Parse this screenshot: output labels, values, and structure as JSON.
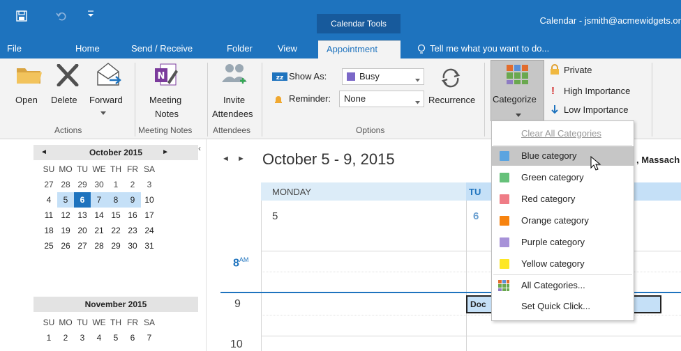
{
  "window": {
    "title": "Calendar - jsmith@acmewidgets.or",
    "contextual_tab_group": "Calendar Tools"
  },
  "tabs": [
    {
      "label": "File"
    },
    {
      "label": "Home"
    },
    {
      "label": "Send / Receive"
    },
    {
      "label": "Folder"
    },
    {
      "label": "View"
    },
    {
      "label": "Appointment"
    },
    {
      "label": "Tell me what you want to do..."
    }
  ],
  "ribbon": {
    "actions": {
      "open": "Open",
      "delete": "Delete",
      "forward": "Forward",
      "group": "Actions"
    },
    "meeting_notes": {
      "label1": "Meeting",
      "label2": "Notes",
      "group": "Meeting Notes"
    },
    "attendees": {
      "label1": "Invite",
      "label2": "Attendees",
      "group": "Attendees"
    },
    "options": {
      "show_as_label": "Show As:",
      "show_as_value": "Busy",
      "reminder_label": "Reminder:",
      "reminder_value": "None",
      "recurrence": "Recurrence",
      "group": "Options"
    },
    "tags": {
      "categorize": "Categorize",
      "private": "Private",
      "high_importance": "High Importance",
      "low_importance": "Low Importance"
    }
  },
  "categorize_menu": {
    "clear_all": "Clear All Categories",
    "items": [
      {
        "label": "Blue category",
        "color": "#5ba4e0"
      },
      {
        "label": "Green category",
        "color": "#66c17a"
      },
      {
        "label": "Red category",
        "color": "#ef7c86"
      },
      {
        "label": "Orange category",
        "color": "#f7830f"
      },
      {
        "label": "Purple category",
        "color": "#a792d8"
      },
      {
        "label": "Yellow category",
        "color": "#fde724"
      }
    ],
    "all_categories": "All Categories...",
    "set_quick_click": "Set Quick Click..."
  },
  "mini_calendar": {
    "october": {
      "title": "October 2015",
      "weekdays": [
        "SU",
        "MO",
        "TU",
        "WE",
        "TH",
        "FR",
        "SA"
      ],
      "weeks": [
        [
          "27",
          "28",
          "29",
          "30",
          "1",
          "2",
          "3"
        ],
        [
          "4",
          "5",
          "6",
          "7",
          "8",
          "9",
          "10"
        ],
        [
          "11",
          "12",
          "13",
          "14",
          "15",
          "16",
          "17"
        ],
        [
          "18",
          "19",
          "20",
          "21",
          "22",
          "23",
          "24"
        ],
        [
          "25",
          "26",
          "27",
          "28",
          "29",
          "30",
          "31"
        ]
      ]
    },
    "november": {
      "title": "November 2015",
      "weekdays": [
        "SU",
        "MO",
        "TU",
        "WE",
        "TH",
        "FR",
        "SA"
      ],
      "weeks": [
        [
          "1",
          "2",
          "3",
          "4",
          "5",
          "6",
          "7"
        ]
      ]
    }
  },
  "calendar": {
    "range_title": "October 5 - 9, 2015",
    "location": ", Massach",
    "columns": [
      {
        "day_name": "MONDAY",
        "date": "5"
      },
      {
        "day_name": "TU",
        "date": "6"
      }
    ],
    "hours": [
      {
        "label": "8",
        "suffix": "AM"
      },
      {
        "label": "9",
        "suffix": ""
      },
      {
        "label": "10",
        "suffix": ""
      }
    ],
    "appointment_text": "Doc"
  },
  "colors": {
    "accent": "#1e73be",
    "today_highlight": "#1e73be",
    "selected_week": "#c5e0f7"
  }
}
